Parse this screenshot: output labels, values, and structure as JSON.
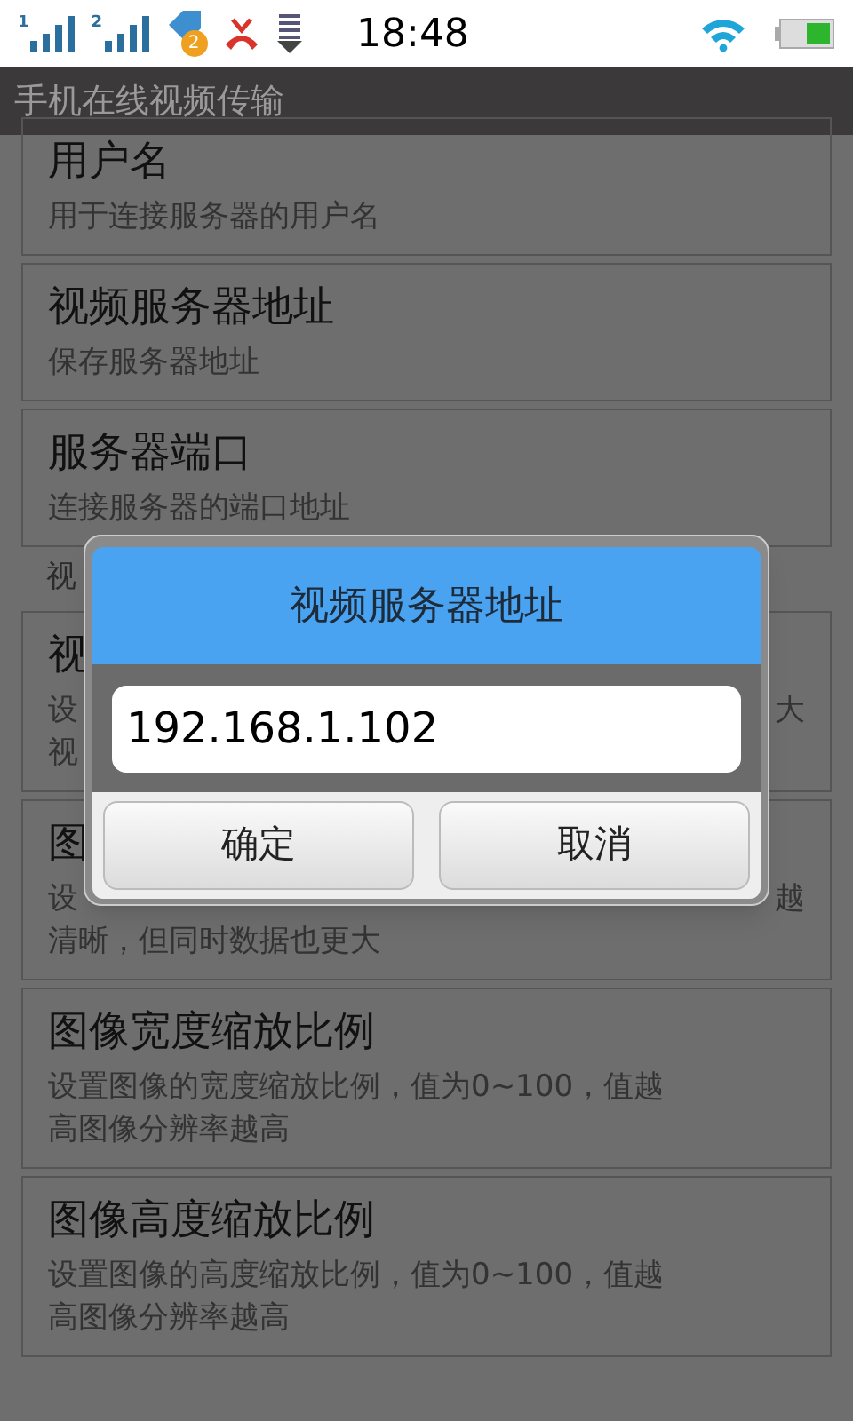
{
  "status_bar": {
    "sims": [
      "1",
      "2"
    ],
    "notification_badge": "2",
    "time": "18:48"
  },
  "app_bar": {
    "title": "手机在线视频传输"
  },
  "settings": [
    {
      "kind": "item",
      "title": "用户名",
      "description": "用于连接服务器的用户名"
    },
    {
      "kind": "item",
      "title": "视频服务器地址",
      "description": "保存服务器地址"
    },
    {
      "kind": "item",
      "title": "服务器端口",
      "description": "连接服务器的端口地址"
    },
    {
      "kind": "header",
      "title": "视"
    },
    {
      "kind": "covered",
      "title": "视",
      "lines": [
        {
          "left": "设",
          "right": "大"
        },
        {
          "left": "视"
        }
      ]
    },
    {
      "kind": "covered",
      "title": "图",
      "lines": [
        {
          "left": "设",
          "right": "越"
        },
        {
          "left": "清晰，但同时数据也更大"
        }
      ]
    },
    {
      "kind": "item",
      "title": "图像宽度缩放比例",
      "description": "设置图像的宽度缩放比例，值为0~100，值越高图像分辨率越高"
    },
    {
      "kind": "item",
      "title": "图像高度缩放比例",
      "description": "设置图像的高度缩放比例，值为0~100，值越高图像分辨率越高"
    }
  ],
  "dialog": {
    "title": "视频服务器地址",
    "value": "192.168.1.102",
    "buttons": [
      "确定",
      "取消"
    ]
  }
}
